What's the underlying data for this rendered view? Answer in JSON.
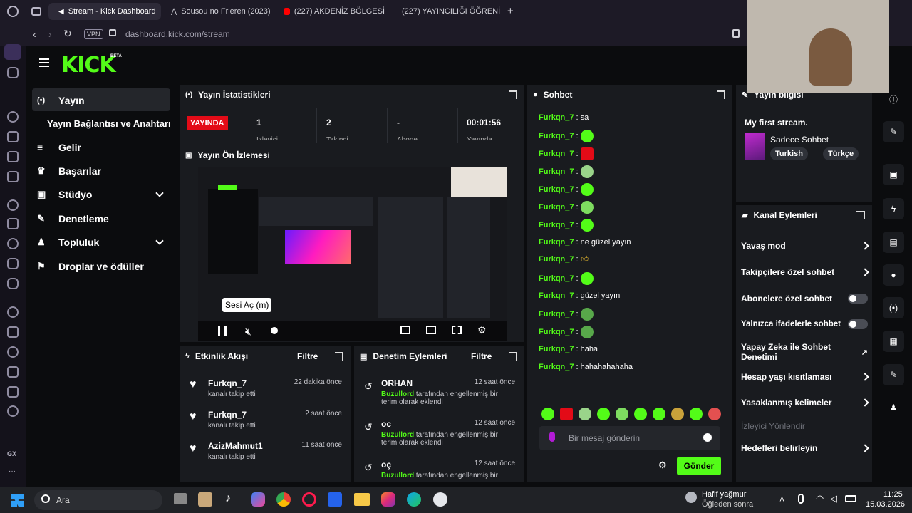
{
  "browser": {
    "tabs": [
      {
        "label": "Stream - Kick Dashboard"
      },
      {
        "label": "Sousou no Frieren (2023)"
      },
      {
        "label": "(227) AKDENİZ BÖLGESİ"
      },
      {
        "label": "(227) YAYINCILIĞI ÖĞRENİ"
      }
    ],
    "new_tab": "+",
    "vpn": "VPN",
    "url": "dashboard.kick.com/stream"
  },
  "brand": {
    "logo": "KICK",
    "beta": "BETA"
  },
  "nav": {
    "items": [
      {
        "label": "Yayın"
      },
      {
        "label": "Yayın Bağlantısı ve Anahtarı"
      },
      {
        "label": "Gelir"
      },
      {
        "label": "Başarılar"
      },
      {
        "label": "Stüdyo"
      },
      {
        "label": "Denetleme"
      },
      {
        "label": "Topluluk"
      },
      {
        "label": "Droplar ve ödüller"
      }
    ]
  },
  "stats": {
    "title": "Yayın İstatistikleri",
    "live_badge": "YAYINDA",
    "items": [
      {
        "value": "1",
        "label": "İzleyici"
      },
      {
        "value": "2",
        "label": "Takipçi"
      },
      {
        "value": "-",
        "label": "Abone"
      },
      {
        "value": "00:01:56",
        "label": "Yayında"
      }
    ]
  },
  "preview": {
    "title": "Yayın Ön İzlemesi",
    "tooltip": "Sesi Aç (m)"
  },
  "activity": {
    "title": "Etkinlik Akışı",
    "filter": "Filtre",
    "items": [
      {
        "user": "Furkqn_7",
        "desc": "kanalı takip etti",
        "time": "22 dakika önce"
      },
      {
        "user": "Furkqn_7",
        "desc": "kanalı takip etti",
        "time": "2 saat önce"
      },
      {
        "user": "AzizMahmut1",
        "desc": "kanalı takip etti",
        "time": "11 saat önce"
      }
    ]
  },
  "moderation": {
    "title": "Denetim Eylemleri",
    "filter": "Filtre",
    "items": [
      {
        "user": "ORHAN",
        "mod": "Buzullord",
        "desc": "tarafından engellenmiş bir terim olarak eklendi",
        "time": "12 saat önce"
      },
      {
        "user": "oc",
        "mod": "Buzullord",
        "desc": "tarafından engellenmiş bir terim olarak eklendi",
        "time": "12 saat önce"
      },
      {
        "user": "oç",
        "mod": "Buzullord",
        "desc": "tarafından engellenmiş bir",
        "time": "12 saat önce"
      }
    ]
  },
  "chat": {
    "title": "Sohbet",
    "messages": [
      {
        "user": "Furkqn_7",
        "text": "sa"
      },
      {
        "user": "Furkqn_7",
        "text": ""
      },
      {
        "user": "Furkqn_7",
        "text": ""
      },
      {
        "user": "Furkqn_7",
        "text": ""
      },
      {
        "user": "Furkqn_7",
        "text": ""
      },
      {
        "user": "Furkqn_7",
        "text": ""
      },
      {
        "user": "Furkqn_7",
        "text": ""
      },
      {
        "user": "Furkqn_7",
        "text": "ne güzel yayın"
      },
      {
        "user": "Furkqn_7",
        "text": ""
      },
      {
        "user": "Furkqn_7",
        "text": ""
      },
      {
        "user": "Furkqn_7",
        "text": "güzel yayın"
      },
      {
        "user": "Furkqn_7",
        "text": ""
      },
      {
        "user": "Furkqn_7",
        "text": ""
      },
      {
        "user": "Furkqn_7",
        "text": "haha"
      },
      {
        "user": "Furkqn_7",
        "text": "hahahahahaha"
      }
    ],
    "placeholder": "Bir mesaj gönderin",
    "send": "Gönder"
  },
  "stream_info": {
    "title": "Yayın bilgisi",
    "stream_title": "My first stream.",
    "category": "Sadece Sohbet",
    "tags": [
      "Turkish",
      "Türkçe"
    ]
  },
  "channel_actions": {
    "title": "Kanal Eylemleri",
    "items": [
      {
        "label": "Yavaş mod",
        "type": "chevron"
      },
      {
        "label": "Takipçilere özel sohbet",
        "type": "chevron"
      },
      {
        "label": "Abonelere özel sohbet",
        "type": "toggle"
      },
      {
        "label": "Yalnızca ifadelerle sohbet",
        "type": "toggle"
      },
      {
        "label": "Yapay Zeka ile Sohbet Denetimi",
        "type": "external"
      },
      {
        "label": "Hesap yaşı kısıtlaması",
        "type": "chevron"
      },
      {
        "label": "Yasaklanmış kelimeler",
        "type": "chevron"
      },
      {
        "label": "İzleyici Yönlendir",
        "type": "disabled"
      },
      {
        "label": "Hedefleri belirleyin",
        "type": "chevron"
      }
    ]
  },
  "taskbar": {
    "search": "Ara",
    "weather_title": "Hafif yağmur",
    "weather_sub": "Öğleden sonra",
    "time": "11:25",
    "date": "15.03.2026"
  },
  "colors": {
    "accent": "#53fc18",
    "live": "#e30b17"
  }
}
